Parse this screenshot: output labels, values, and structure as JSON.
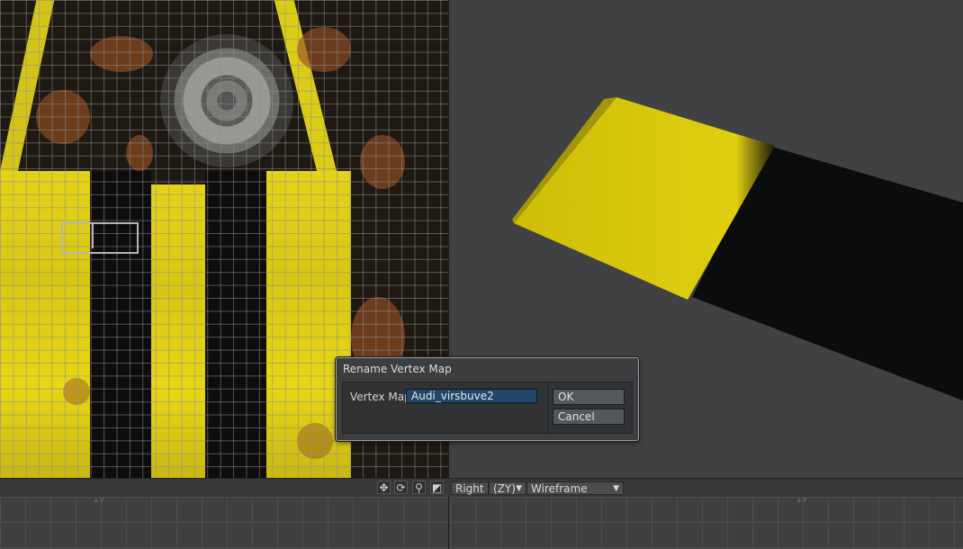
{
  "dialog": {
    "title": "Rename Vertex Map",
    "field_label": "Vertex Map",
    "field_value": "Audi_virsbuve2",
    "ok_label": "OK",
    "cancel_label": "Cancel"
  },
  "viewport_bar": {
    "view_label": "Right",
    "axis_label": "(ZY)",
    "render_mode": "Wireframe"
  },
  "bottom_grid": {
    "axis_left": "+Y",
    "axis_right": "+Y"
  },
  "icons": {
    "pan": "move-icon",
    "rotate": "rotate-icon",
    "zoom": "zoom-icon",
    "maximize": "maximize-icon"
  },
  "colors": {
    "texture_yellow": "#e8d714",
    "input_bg": "#23476b",
    "viewport_bg": "#3f4143"
  }
}
